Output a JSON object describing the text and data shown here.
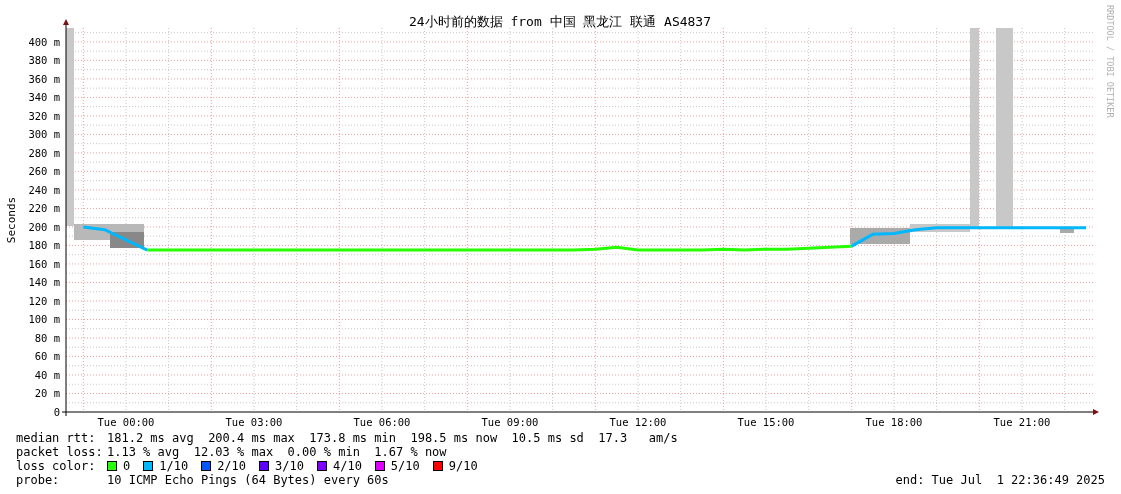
{
  "graph": {
    "watermark_credit": "RRDTOOL / TOBI OETIKER",
    "chart_data": {
      "type": "line",
      "title": "24小时前的数据 from 中国 黑龙江 联通 AS4837",
      "ylabel": "Seconds",
      "categories": [
        null,
        null,
        "Tue 00:00",
        null,
        null,
        null,
        null,
        null,
        "Tue 03:00",
        null,
        null,
        null,
        null,
        null,
        "Tue 06:00",
        null,
        null,
        null,
        null,
        null,
        "Tue 09:00",
        null,
        null,
        null,
        null,
        null,
        "Tue 12:00",
        null,
        null,
        null,
        null,
        null,
        "Tue 15:00",
        null,
        null,
        null,
        null,
        null,
        "Tue 18:00",
        null,
        null,
        null,
        null,
        null,
        "Tue 21:00",
        null,
        null,
        null
      ],
      "grid": true,
      "ylim": [
        0,
        415
      ],
      "yticks": [
        {
          "value": 0,
          "label": "0"
        },
        {
          "value": 20,
          "label": "20 m"
        },
        {
          "value": 40,
          "label": "40 m"
        },
        {
          "value": 60,
          "label": "60 m"
        },
        {
          "value": 80,
          "label": "80 m"
        },
        {
          "value": 100,
          "label": "100 m"
        },
        {
          "value": 120,
          "label": "120 m"
        },
        {
          "value": 140,
          "label": "140 m"
        },
        {
          "value": 160,
          "label": "160 m"
        },
        {
          "value": 180,
          "label": "180 m"
        },
        {
          "value": 200,
          "label": "200 m"
        },
        {
          "value": 220,
          "label": "220 m"
        },
        {
          "value": 240,
          "label": "240 m"
        },
        {
          "value": 260,
          "label": "260 m"
        },
        {
          "value": 280,
          "label": "280 m"
        },
        {
          "value": 300,
          "label": "300 m"
        },
        {
          "value": 320,
          "label": "320 m"
        },
        {
          "value": 340,
          "label": "340 m"
        },
        {
          "value": 360,
          "label": "360 m"
        },
        {
          "value": 380,
          "label": "380 m"
        },
        {
          "value": 400,
          "label": "400 m"
        }
      ],
      "series": [
        {
          "color": "#26ff00",
          "values": [
            null,
            null,
            null,
            175,
            175,
            175,
            175,
            175,
            175,
            175,
            175,
            175,
            175,
            175,
            175,
            175,
            175,
            175,
            175,
            175,
            175,
            175,
            175,
            175,
            176,
            178,
            175,
            175,
            175,
            175,
            176,
            175,
            176,
            176,
            177,
            178,
            179,
            null,
            null,
            null,
            null,
            null,
            null,
            null,
            null,
            null,
            null,
            null
          ]
        },
        {
          "color": "#00b8ff",
          "values": [
            200,
            197,
            186,
            175,
            null,
            null,
            null,
            null,
            null,
            null,
            null,
            null,
            null,
            null,
            null,
            null,
            null,
            null,
            null,
            null,
            null,
            null,
            null,
            null,
            null,
            null,
            null,
            null,
            null,
            null,
            null,
            null,
            null,
            null,
            null,
            null,
            179,
            192,
            193,
            197,
            199,
            199,
            199,
            199,
            199,
            199,
            199,
            199
          ]
        }
      ]
    }
  },
  "legend": {
    "stats": [
      {
        "label": "median rtt:",
        "text": "181.2 ms avg  200.4 ms max  173.8 ms min  198.5 ms now  10.5 ms sd  17.3   am/s"
      },
      {
        "label": "packet loss:",
        "text": "1.13 % avg  12.03 % max  0.00 % min  1.67 % now"
      }
    ],
    "loss_color_label": "loss color:",
    "loss_colors": [
      {
        "label": "0",
        "color": "#26ff00"
      },
      {
        "label": "1/10",
        "color": "#00b8ff"
      },
      {
        "label": "2/10",
        "color": "#0059ff"
      },
      {
        "label": "3/10",
        "color": "#5e00ff"
      },
      {
        "label": "4/10",
        "color": "#7e00ff"
      },
      {
        "label": "5/10",
        "color": "#dd00ff"
      },
      {
        "label": "9/10",
        "color": "#ff0000"
      }
    ],
    "probe_label": "probe:",
    "probe": "10 ICMP Echo Pings (64 Bytes) every 60s",
    "end": "end: Tue Jul  1 22:36:49 2025"
  }
}
